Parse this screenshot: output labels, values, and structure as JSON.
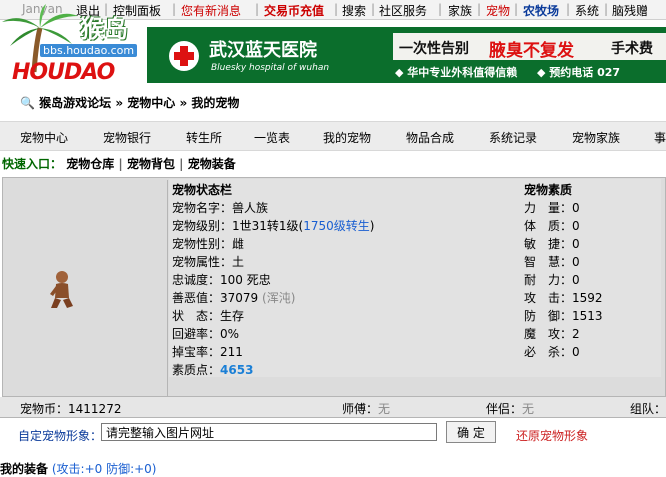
{
  "topnav": {
    "username": "Janyan",
    "logout": "退出",
    "control_panel": "控制面板",
    "new_message": "您有新消息",
    "trade_coin": "交易币充值",
    "search": "搜索",
    "community": "社区服务",
    "family": "家族",
    "pets": "宠物",
    "ranch": "农牧场",
    "system": "系统",
    "brain": "脑残赠"
  },
  "logo": {
    "title": "猴岛",
    "url": "bbs.houdao.com",
    "wordmark": "HOUDAO"
  },
  "banner": {
    "hospital_name": "武汉蓝天医院",
    "hospital_en": "Bluesky hospital of wuhan",
    "slogan_prefix": "一次性告别",
    "slogan_main": "腋臭不复发",
    "slogan_suffix": "手术费",
    "subline_left": "◆ 华中专业外科值得信赖",
    "subline_right": "◆ 预约电话 027"
  },
  "breadcrumb": {
    "root": "猴岛游戏论坛",
    "center": "宠物中心",
    "current": "我的宠物"
  },
  "menu": {
    "items": [
      "宠物中心",
      "宠物银行",
      "转生所",
      "一览表",
      "我的宠物",
      "物品合成",
      "系统记录",
      "宠物家族",
      "事"
    ]
  },
  "quick": {
    "label": "快速入口：",
    "links": [
      "宠物仓库",
      "宠物背包",
      "宠物装备"
    ]
  },
  "status": {
    "title": "宠物状态栏",
    "name_label": "宠物名字：",
    "name": "兽人族",
    "level_label": "宠物级别：",
    "level": "1世31转1级(",
    "level_link": "1750级转生",
    "level_close": ")",
    "gender_label": "宠物性别：",
    "gender": "雌",
    "attr_label": "宠物属性：",
    "attr": "土",
    "loyal_label": "忠诚度：",
    "loyal": "100 死忠",
    "kind_label": "善恶值：",
    "kind": "37079",
    "kind_note": "(浑沌)",
    "state_label": "状　态：",
    "state": "生存",
    "evade_label": "回避率：",
    "evade": "0%",
    "drop_label": "掉宝率：",
    "drop": "211",
    "points_label": "素质点：",
    "points": "4653"
  },
  "attrs": {
    "title": "宠物素质",
    "rows": [
      {
        "label": "力　量：",
        "value": "0"
      },
      {
        "label": "体　质：",
        "value": "0"
      },
      {
        "label": "敏　捷：",
        "value": "0"
      },
      {
        "label": "智　慧：",
        "value": "0"
      },
      {
        "label": "耐　力：",
        "value": "0"
      },
      {
        "label": "攻　击：",
        "value": "1592"
      },
      {
        "label": "防　御：",
        "value": "1513"
      },
      {
        "label": "魔　攻：",
        "value": "2"
      },
      {
        "label": "必　杀：",
        "value": "0"
      }
    ]
  },
  "footer": {
    "coin_label": "宠物币：",
    "coin": "1411272",
    "master_label": "师傅：",
    "master": "无",
    "partner_label": "伴侣：",
    "partner": "无",
    "group_label": "组队："
  },
  "custom": {
    "label": "自定宠物形象：",
    "placeholder": "请完整输入图片网址",
    "ok": "确 定",
    "restore": "还原宠物形象"
  },
  "equip": {
    "label": "我的装备",
    "stats": "(攻击:+0 防御:+0)"
  },
  "colors": {
    "accent_red": "#cc0000",
    "link_blue": "#1a5fd1",
    "banner_green": "#0b6e2c"
  }
}
